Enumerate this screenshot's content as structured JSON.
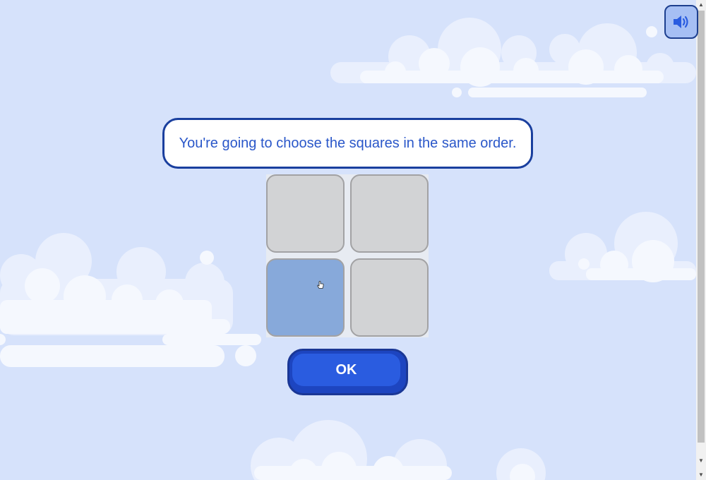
{
  "instruction": {
    "text": "You're going to choose the squares in the same order."
  },
  "grid": {
    "tiles": [
      {
        "id": "tile-1",
        "state": "default"
      },
      {
        "id": "tile-2",
        "state": "default"
      },
      {
        "id": "tile-3",
        "state": "highlighted"
      },
      {
        "id": "tile-4",
        "state": "default"
      }
    ]
  },
  "ok_button": {
    "label": "OK"
  },
  "sound_button": {
    "icon": "speaker-icon"
  },
  "colors": {
    "background": "#d6e2fb",
    "tile_default": "#d2d3d5",
    "tile_highlighted": "#87a9da",
    "primary_blue": "#2a5ce0",
    "text_blue": "#2a57c9"
  }
}
